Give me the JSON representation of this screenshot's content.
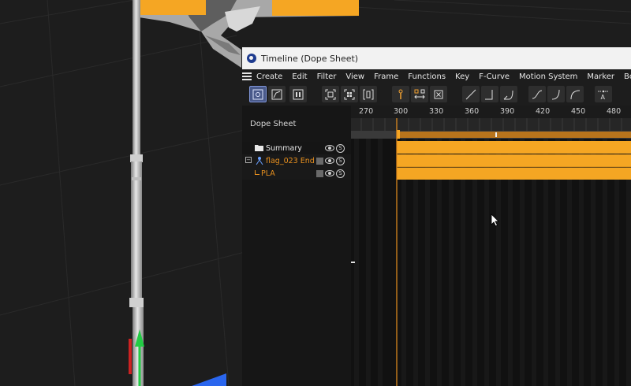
{
  "window": {
    "title": "Timeline (Dope Sheet)"
  },
  "menu": {
    "items": [
      "Create",
      "Edit",
      "Filter",
      "View",
      "Frame",
      "Functions",
      "Key",
      "F-Curve",
      "Motion System",
      "Marker",
      "Bookmarks"
    ]
  },
  "toolbar": {
    "buttons": [
      "dope-sheet-mode-icon",
      "f-curve-mode-icon",
      "motion-mode-icon",
      "frame-all-icon",
      "frame-selected-icon",
      "frame-preview-icon",
      "key-insert-icon",
      "key-scale-icon",
      "key-delete-icon",
      "linear-icon",
      "step-icon",
      "ease-in-icon",
      "spline-icon",
      "ease-out-icon",
      "ease-in-out-icon",
      "tangent-text-icon"
    ]
  },
  "panel": {
    "title": "Dope Sheet",
    "rows": {
      "summary": "Summary",
      "object": "flag_023 End",
      "track": "PLA"
    }
  },
  "ruler": {
    "ticks": [
      "270",
      "300",
      "330",
      "360",
      "390",
      "420",
      "450",
      "480"
    ]
  },
  "colors": {
    "accent": "#f0a030",
    "key_track": "#f5a623",
    "active_button": "#4a5a8a",
    "object_text": "#e8901f"
  }
}
